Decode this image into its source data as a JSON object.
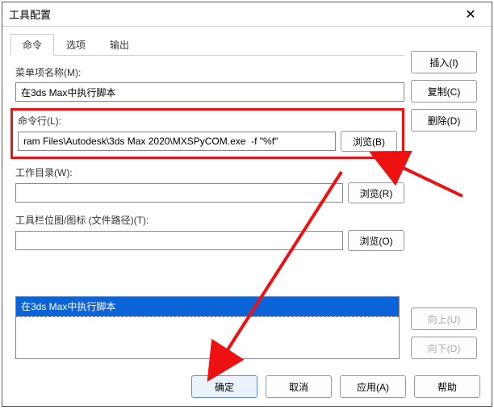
{
  "window": {
    "title": "工具配置"
  },
  "tabs": [
    "命令",
    "选项",
    "输出"
  ],
  "labels": {
    "menu_name": "菜单项名称(M):",
    "command_line": "命令行(L):",
    "work_dir": "工作目录(W):",
    "toolbar_icon": "工具栏位图/图标 (文件路径)(T):"
  },
  "values": {
    "menu_name": "在3ds Max中执行脚本",
    "command_line": "ram Files\\Autodesk\\3ds Max 2020\\MXSPyCOM.exe  -f \"%f\"",
    "work_dir": "",
    "toolbar_icon": ""
  },
  "buttons": {
    "browse_b": "浏览(B)",
    "browse_r": "浏览(R)",
    "browse_o": "浏览(O)",
    "insert": "插入(I)",
    "copy": "复制(C)",
    "delete": "删除(D)",
    "up": "向上(U)",
    "down": "向下(D)",
    "ok": "确定",
    "cancel": "取消",
    "apply": "应用(A)",
    "help": "帮助"
  },
  "list": {
    "items": [
      "在3ds Max中执行脚本"
    ]
  }
}
